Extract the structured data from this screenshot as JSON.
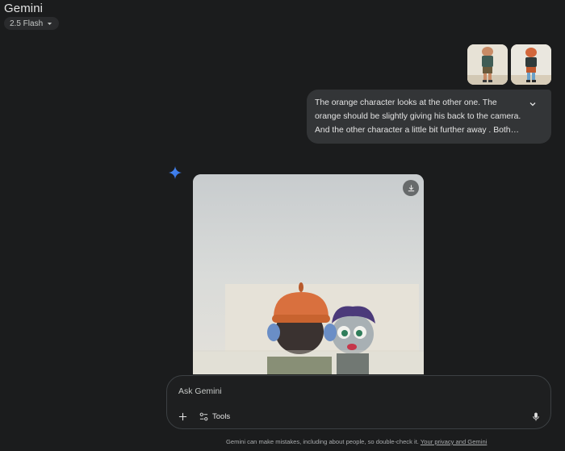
{
  "header": {
    "title": "Gemini",
    "model_label": "2.5 Flash"
  },
  "conversation": {
    "attachments": [
      {
        "name": "character-thumbnail-1"
      },
      {
        "name": "character-thumbnail-2"
      }
    ],
    "user_message": "The orange character looks at the other one. The orange should be slightly giving his back to the camera. And the other character a little bit further away . Both looking at each other"
  },
  "composer": {
    "placeholder": "Ask Gemini",
    "tools_label": "Tools"
  },
  "footer": {
    "disclaimer": "Gemini can make mistakes, including about people, so double-check it.",
    "privacy_link": "Your privacy and Gemini"
  },
  "colors": {
    "background": "#1b1c1d",
    "bubble": "#333537",
    "accent": "#4285f4"
  },
  "icons": {
    "model_chip": "caret-down-icon",
    "bubble": "chevron-down-icon",
    "spark": "gemini-spark-icon",
    "download": "download-icon",
    "add": "plus-icon",
    "tools": "tools-sliders-icon",
    "mic": "microphone-icon"
  }
}
